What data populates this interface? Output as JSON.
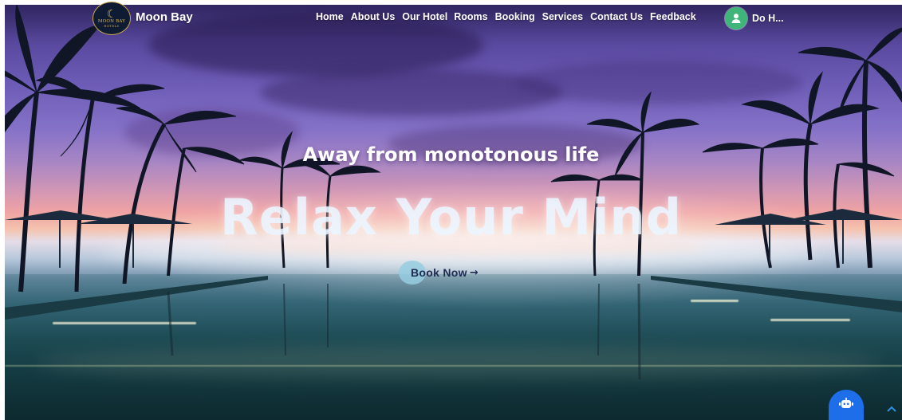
{
  "brand": {
    "logo_text": "MOON BAY",
    "logo_sub": "HOTELS",
    "name": "Moon Bay"
  },
  "nav": {
    "items": [
      {
        "label": "Home"
      },
      {
        "label": "About Us"
      },
      {
        "label": "Our Hotel"
      },
      {
        "label": "Rooms"
      },
      {
        "label": "Booking"
      },
      {
        "label": "Services"
      },
      {
        "label": "Contact Us"
      },
      {
        "label": "Feedback"
      }
    ],
    "user_name": "Do H..."
  },
  "hero": {
    "tagline": "Away from monotonous life",
    "headline": "Relax Your Mind",
    "cta_label": "Book Now",
    "cta_arrow": "→"
  },
  "floating": {
    "chat_icon": "robot-icon",
    "scroll_icon": "chevron-up-icon"
  },
  "colors": {
    "accent": "#1d6ee8",
    "avatar": "#3fb57a",
    "cta_circle": "#96cde1",
    "cta_text": "#1f2b52"
  }
}
